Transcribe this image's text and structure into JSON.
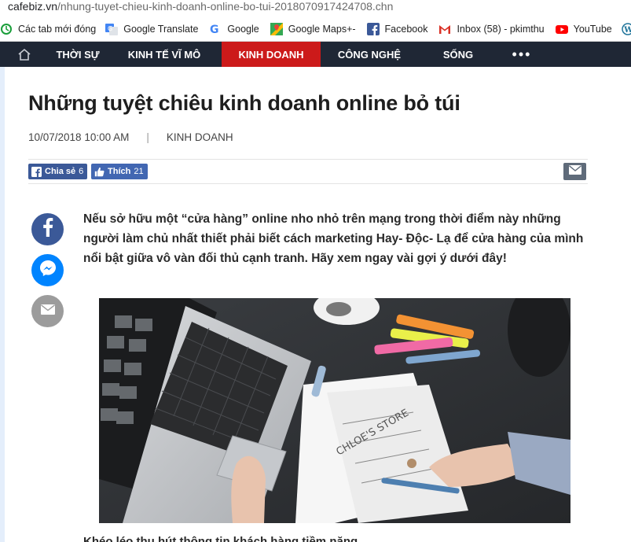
{
  "browser": {
    "url_host": "cafebiz.vn",
    "url_path": "/nhung-tuyet-chieu-kinh-doanh-online-bo-tui-2018070917424708.chn",
    "bookmarks": [
      {
        "label": "Các tab mới đóng",
        "icon": "restore-icon"
      },
      {
        "label": "Google Translate",
        "icon": "google-translate-icon"
      },
      {
        "label": "Google",
        "icon": "google-icon"
      },
      {
        "label": "Google Maps+-",
        "icon": "google-maps-icon"
      },
      {
        "label": "Facebook",
        "icon": "facebook-icon"
      },
      {
        "label": "Inbox (58) - pkimthu",
        "icon": "gmail-icon"
      },
      {
        "label": "YouTube",
        "icon": "youtube-icon"
      },
      {
        "label": "",
        "icon": "wordpress-icon"
      }
    ]
  },
  "nav": {
    "items": [
      "THỜI SỰ",
      "KINH TẾ VĨ MÔ",
      "KINH DOANH",
      "CÔNG NGHỆ",
      "SỐNG"
    ],
    "active": "KINH DOANH",
    "more": "•••"
  },
  "article": {
    "title": "Những tuyệt chiêu kinh doanh online bỏ túi",
    "date": "10/07/2018 10:00 AM",
    "separator": "|",
    "category": "KINH DOANH",
    "share_label": "Chia sẻ",
    "share_count": "6",
    "like_label": "Thích",
    "like_count": "21",
    "lead": "Nếu sở hữu một “cửa hàng” online nho nhỏ trên mạng trong thời điểm này những người làm chủ nhất thiết phải biết cách marketing Hay- Độc- Lạ để cửa hàng của mình nổi bật giữa vô vàn đối thủ cạnh tranh. Hãy xem ngay vài gợi ý dưới đây!",
    "next_line": "Khéo léo thu hút thông tin khách hàng tiềm năng"
  },
  "colors": {
    "nav_bg": "#1f2735",
    "nav_active": "#cc1a1a",
    "facebook_blue": "#3b5998",
    "messenger_blue": "#0084ff"
  }
}
